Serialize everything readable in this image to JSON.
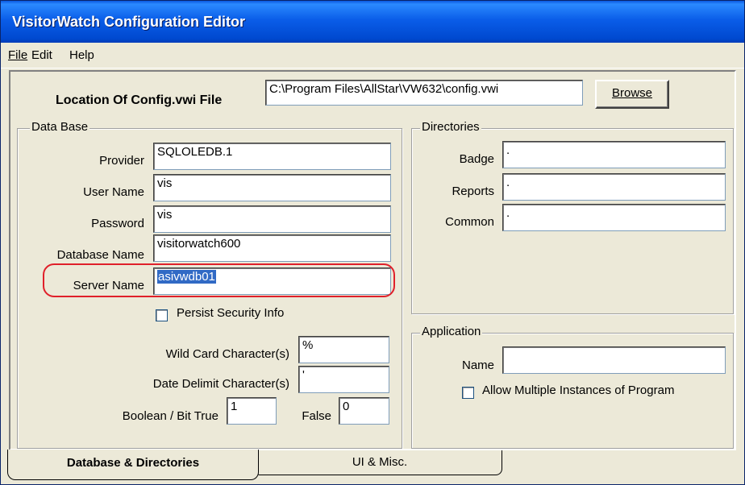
{
  "window": {
    "title": "VisitorWatch Configuration Editor"
  },
  "menu": [
    {
      "label": "File"
    },
    {
      "label": "Edit"
    },
    {
      "label": "Help"
    }
  ],
  "config_location": {
    "label": "Location Of Config.vwi File",
    "value": "C:\\Program Files\\AllStar\\VW632\\config.vwi",
    "browse_label": "Browse"
  },
  "database": {
    "legend": "Data Base",
    "provider": {
      "label": "Provider",
      "value": "SQLOLEDB.1"
    },
    "user_name": {
      "label": "User Name",
      "value": "vis"
    },
    "password": {
      "label": "Password",
      "value": "vis"
    },
    "database_name": {
      "label": "Database Name",
      "value": "visitorwatch600"
    },
    "server_name": {
      "label": "Server Name",
      "value": "asivwdb01"
    },
    "persist_security": {
      "label": "Persist Security Info",
      "checked": false
    },
    "wild_card": {
      "label": "Wild Card Character(s)",
      "value": "%"
    },
    "date_delimit": {
      "label": "Date Delimit Character(s)",
      "value": "'"
    },
    "boolean_true": {
      "label": "Boolean / Bit True",
      "value": "1"
    },
    "boolean_false": {
      "label": "False",
      "value": "0"
    }
  },
  "directories": {
    "legend": "Directories",
    "badge": {
      "label": "Badge",
      "value": "."
    },
    "reports": {
      "label": "Reports",
      "value": "."
    },
    "common": {
      "label": "Common",
      "value": "."
    }
  },
  "application": {
    "legend": "Application",
    "name": {
      "label": "Name",
      "value": ""
    },
    "allow_multiple": {
      "label": "Allow Multiple Instances of Program",
      "checked": false
    }
  },
  "tabs": [
    {
      "label": "Database & Directories",
      "active": true
    },
    {
      "label": "UI & Misc.",
      "active": false
    }
  ],
  "colors": {
    "titlebar": "#0a5de8",
    "highlight_annotation": "#e0202a",
    "selection": "#316ac5",
    "dialog_bg": "#ece9d8"
  }
}
